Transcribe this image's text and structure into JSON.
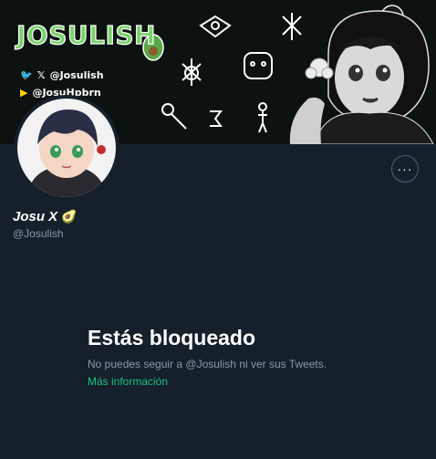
{
  "banner": {
    "brand": "JOSULISH",
    "social": [
      {
        "icons": "bird-icon x-icon",
        "handle": "@Josulish"
      },
      {
        "icons": "play-icon",
        "handle": "@JosuHpbrn"
      }
    ]
  },
  "profile": {
    "display_name": "Josu X",
    "emoji": "🥑",
    "handle": "@Josulish"
  },
  "more_button": {
    "label": "···"
  },
  "blocked": {
    "title": "Estás bloqueado",
    "description": "No puedes seguir a @Josulish ni ver sus Tweets.",
    "link": "Más información"
  },
  "colors": {
    "background": "#15202b",
    "muted_text": "#8b98a5",
    "link": "#19c37d",
    "brand_green": "#7ad26a"
  }
}
